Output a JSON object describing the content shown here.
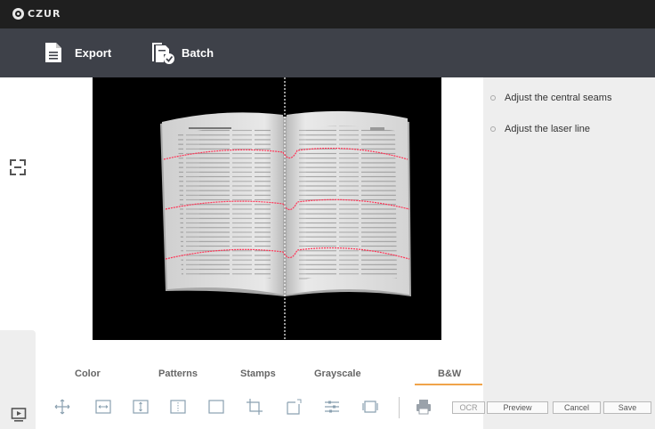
{
  "app": {
    "logo_text": "CZUR"
  },
  "toolbar": {
    "export_label": "Export",
    "batch_label": "Batch"
  },
  "right_panel": {
    "options": [
      {
        "label": "Adjust the central seams"
      },
      {
        "label": "Adjust the laser line"
      }
    ]
  },
  "modes": {
    "tabs": [
      {
        "label": "Color"
      },
      {
        "label": "Patterns"
      },
      {
        "label": "Stamps"
      },
      {
        "label": "Grayscale"
      },
      {
        "label": "B&W",
        "active": true
      }
    ]
  },
  "tools": {
    "icons": [
      "move-icon",
      "fit-width-icon",
      "fit-height-icon",
      "split-icon",
      "select-area-icon",
      "crop-icon",
      "rotate-crop-icon",
      "adjust-icon",
      "frame-icon",
      "print-icon"
    ]
  },
  "actions": {
    "ocr_label": "OCR",
    "preview_label": "Preview",
    "cancel_label": "Cancel",
    "save_label": "Save"
  },
  "colors": {
    "accent": "#f0a34a",
    "toolbar_bg": "#3e4149",
    "titlebar_bg": "#1f1f1f",
    "laser_line": "#ff3355"
  }
}
